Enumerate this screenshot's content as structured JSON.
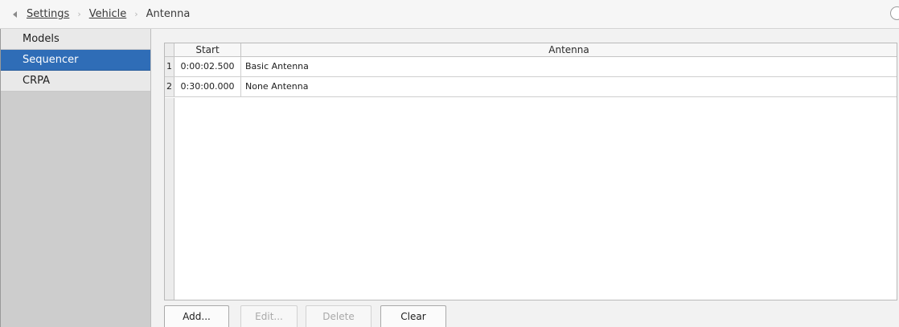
{
  "breadcrumb": {
    "items": [
      "Settings",
      "Vehicle"
    ],
    "current": "Antenna",
    "separator": "›"
  },
  "sidebar": {
    "items": [
      {
        "label": "Models"
      },
      {
        "label": "Sequencer",
        "selected": true
      },
      {
        "label": "CRPA"
      }
    ]
  },
  "table": {
    "columns": [
      "Start",
      "Antenna"
    ],
    "rows": [
      {
        "num": "1",
        "start": "0:00:02.500",
        "antenna": "Basic Antenna"
      },
      {
        "num": "2",
        "start": "0:30:00.000",
        "antenna": "None Antenna"
      }
    ]
  },
  "buttons": {
    "add": "Add...",
    "edit": "Edit...",
    "delete": "Delete",
    "clear": "Clear"
  },
  "colors": {
    "selection": "#2f6db7",
    "sidebar_bg": "#cdcdcd"
  }
}
